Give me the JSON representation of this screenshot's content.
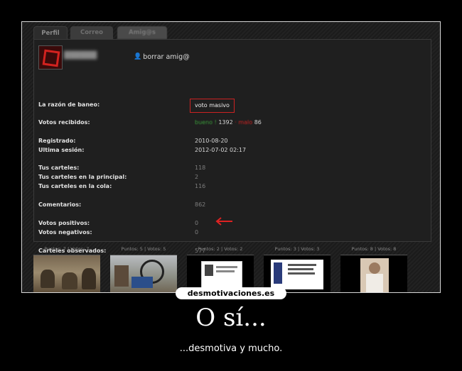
{
  "tabs": [
    "Perfil",
    "Correo",
    "Amig@s"
  ],
  "profile": {
    "delete_friend_label": "borrar amig@",
    "ban": {
      "label": "La razón de baneo:",
      "value": "voto masivo"
    },
    "votes_received": {
      "label": "Votos recibidos:",
      "good": "bueno ! ",
      "good_count": "1392",
      "sep": " · ",
      "bad": " malo",
      "bad_count": "86"
    },
    "registered": {
      "label": "Registrado:",
      "value": "2010-08-20"
    },
    "last_session": {
      "label": "Ultima sesión:",
      "value": "2012-07-02 02:17"
    },
    "posters": {
      "label": "Tus carteles:",
      "value": "118"
    },
    "posters_main": {
      "label": "Tus carteles en la principal:",
      "value": "2"
    },
    "posters_queue": {
      "label": "Tus carteles en la cola:",
      "value": "116"
    },
    "comments": {
      "label": "Comentarios:",
      "value": "862"
    },
    "positive_votes": {
      "label": "Votos positivos:",
      "value": "0"
    },
    "negative_votes": {
      "label": "Votos negativos:",
      "value": "0"
    },
    "observed": {
      "label": "Carteles observados:",
      "value": "577"
    }
  },
  "thumbnails": [
    {
      "label": "Puntos: 7 | Votos: 7"
    },
    {
      "label": "Puntos: 5 | Votos: 5"
    },
    {
      "label": "Puntos: 2 | Votos: 2"
    },
    {
      "label": "Puntos: 3 | Votos: 3"
    },
    {
      "label": "Puntos: 8 | Votos: 8"
    }
  ],
  "brand": "desmotivaciones.es",
  "poster_title": "O sí...",
  "poster_subtitle": "...desmotiva y mucho.",
  "colors": {
    "highlight_red": "#cc2222",
    "good_green": "#3a9b3a",
    "background": "#000000",
    "text": "#ffffff"
  }
}
